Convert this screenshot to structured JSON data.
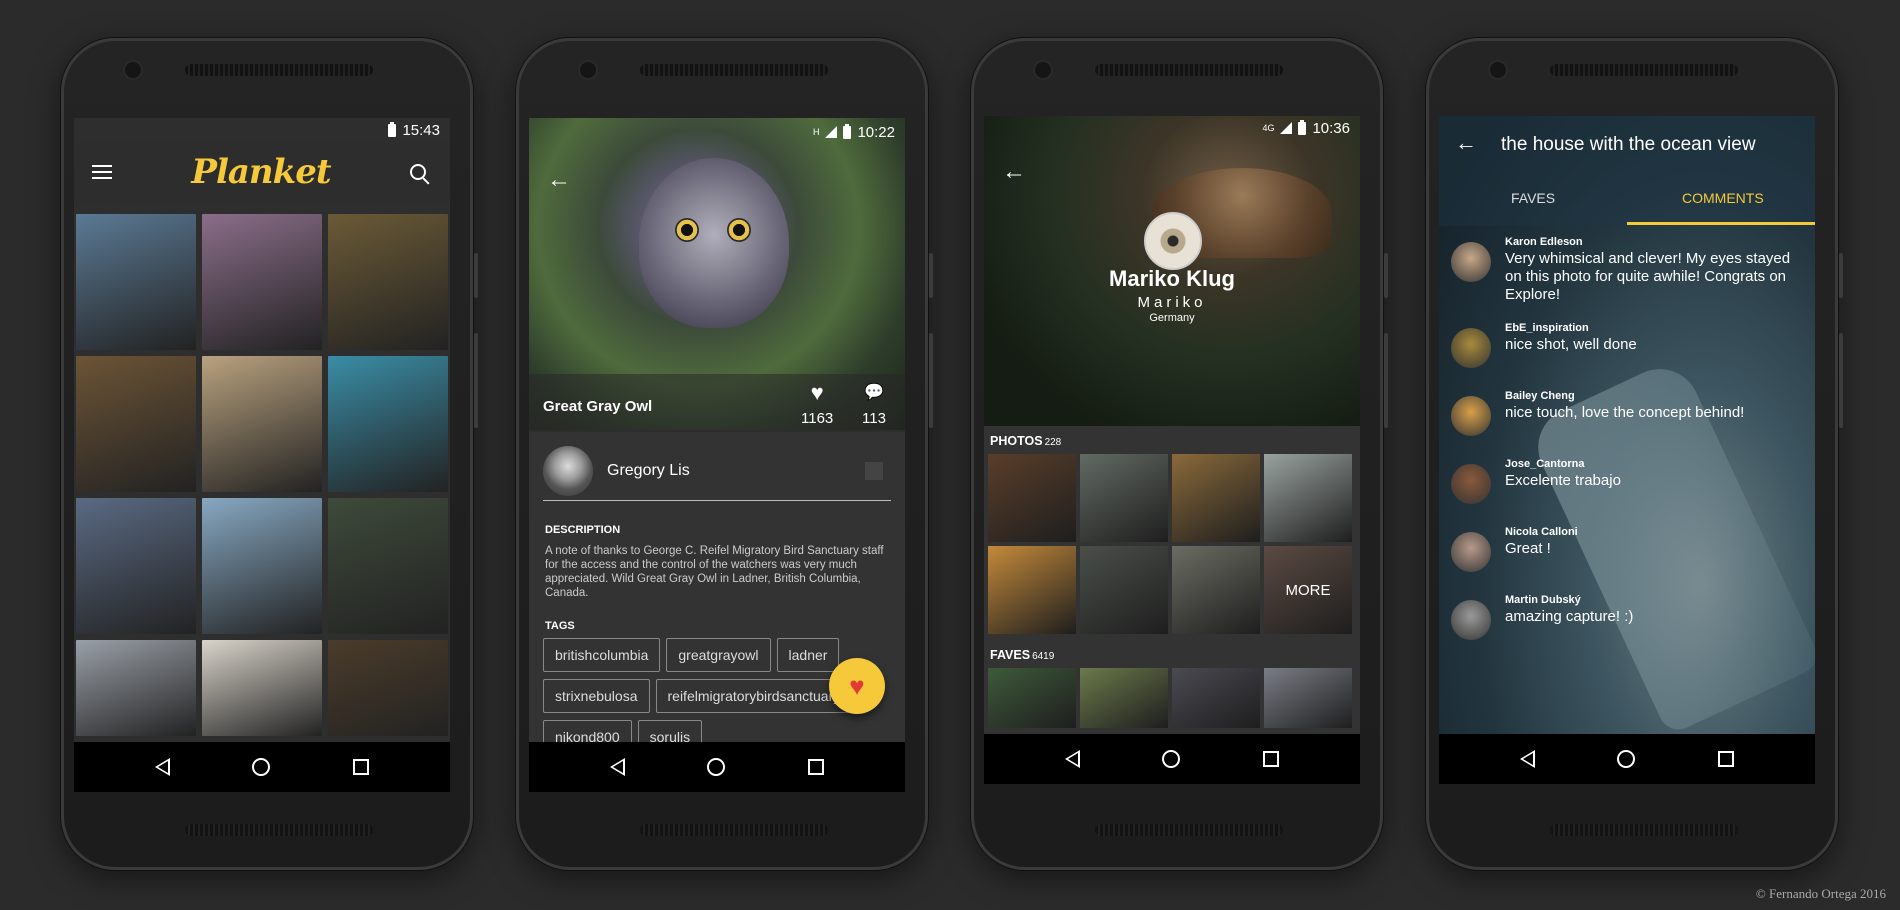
{
  "phone1": {
    "time": "15:43",
    "app_name": "Planket",
    "thumbs": [
      "#5b7a95",
      "#8b6e8a",
      "#6b5a36",
      "#6c5436",
      "#b9a27f",
      "#3a8da6",
      "#5a6a83",
      "#87a8c2",
      "#3e4a3a",
      "#9aa0a8",
      "#d9d4ca",
      "#4b3c2a"
    ]
  },
  "phone2": {
    "time": "10:22",
    "photo_title": "Great Gray Owl",
    "likes": "1163",
    "comments": "113",
    "author": "Gregory Lis",
    "description_label": "DESCRIPTION",
    "description": "A note of thanks to George C. Reifel Migratory Bird Sanctuary staff for the access and the control of the watchers was very much appreciated. Wild Great Gray Owl in Ladner, British Columbia, Canada.",
    "tags_label": "TAGS",
    "tags": [
      "britishcolumbia",
      "greatgrayowl",
      "ladner",
      "strixnebulosa",
      "reifelmigratorybirdsanctuary",
      "nikond800",
      "sorulis"
    ]
  },
  "phone3": {
    "time": "10:36",
    "name": "Mariko Klug",
    "username": "Mariko",
    "country": "Germany",
    "photos_label": "PHOTOS",
    "photos_count": "228",
    "more_label": "MORE",
    "faves_label": "FAVES",
    "faves_count": "6419",
    "photos": [
      "#5a3e2a",
      "#626a63",
      "#8a6a3a",
      "#9aa3a0",
      "#c48a3a",
      "#4a4f4a",
      "#6b6d63",
      "#5b4a42"
    ],
    "faves": [
      "#3e5a3a",
      "#6b7a4a",
      "#4a4a52",
      "#7a7d86"
    ]
  },
  "phone4": {
    "title": "the house with the ocean view",
    "tab_faves": "FAVES",
    "tab_comments": "COMMENTS",
    "comments": [
      {
        "name": "Karon Edleson",
        "text": "Very whimsical and clever! My eyes stayed on this photo for quite awhile! Congrats on Explore!",
        "color": "#c8a888"
      },
      {
        "name": "EbE_inspiration",
        "text": "nice shot, well done",
        "color": "#a88a3a"
      },
      {
        "name": "Bailey Cheng",
        "text": "nice touch, love the concept behind!",
        "color": "#d9a04a"
      },
      {
        "name": "Jose_Cantorna",
        "text": "Excelente trabajo",
        "color": "#8a5a3a"
      },
      {
        "name": "Nicola Calloni",
        "text": "Great !",
        "color": "#b89a8a"
      },
      {
        "name": "Martin Dubský",
        "text": "amazing capture! :)",
        "color": "#9a9a9a"
      }
    ]
  },
  "copyright": "© Fernando Ortega 2016"
}
